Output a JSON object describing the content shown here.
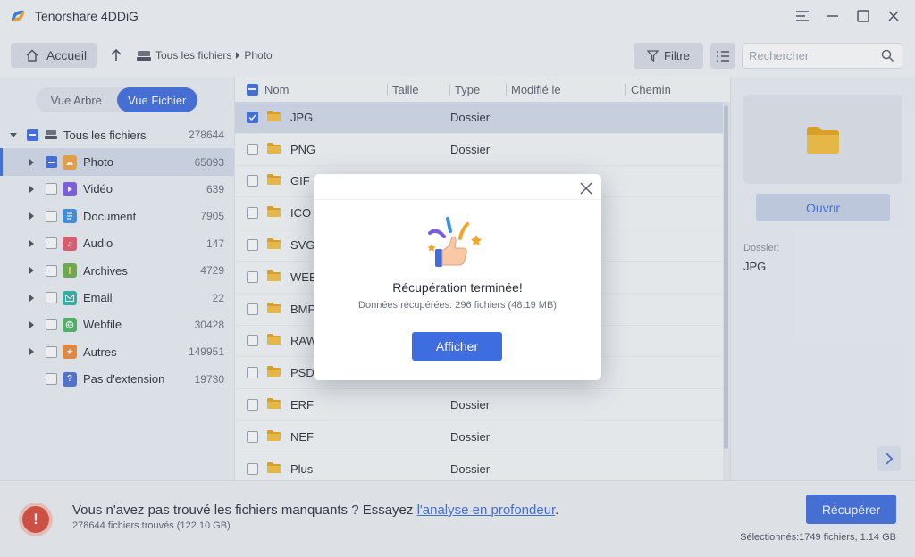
{
  "app": {
    "title": "Tenorshare 4DDiG",
    "brand_color": "#3d6de0"
  },
  "window_controls": [
    "menu-icon",
    "minimize-icon",
    "maximize-icon",
    "close-icon"
  ],
  "toolbar": {
    "home_label": "Accueil",
    "breadcrumb": [
      "Tous les fichiers",
      "Photo"
    ],
    "filter_label": "Filtre",
    "search_placeholder": "Rechercher"
  },
  "view_toggle": {
    "tree_label": "Vue Arbre",
    "file_label": "Vue Fichier",
    "active": "Vue Fichier"
  },
  "tree": {
    "root": {
      "label": "Tous les fichiers",
      "count": "278644"
    },
    "items": [
      {
        "label": "Photo",
        "count": "65093",
        "icon": "photo-icon",
        "color": "#f0a540"
      },
      {
        "label": "Vidéo",
        "count": "639",
        "icon": "video-icon",
        "color": "#7b5ce0"
      },
      {
        "label": "Document",
        "count": "7905",
        "icon": "document-icon",
        "color": "#3d8fe0"
      },
      {
        "label": "Audio",
        "count": "147",
        "icon": "audio-icon",
        "color": "#e55a6e"
      },
      {
        "label": "Archives",
        "count": "4729",
        "icon": "archive-icon",
        "color": "#6fae4e"
      },
      {
        "label": "Email",
        "count": "22",
        "icon": "email-icon",
        "color": "#2fb3a6"
      },
      {
        "label": "Webfile",
        "count": "30428",
        "icon": "webfile-icon",
        "color": "#4bb562"
      },
      {
        "label": "Autres",
        "count": "149951",
        "icon": "other-icon",
        "color": "#f08a3a"
      },
      {
        "label": "Pas d'extension",
        "count": "19730",
        "icon": "unknown-icon",
        "color": "#4d72d6"
      }
    ]
  },
  "file_list": {
    "columns": [
      "Nom",
      "Taille",
      "Type",
      "Modifié le",
      "Chemin"
    ],
    "rows": [
      {
        "name": "JPG",
        "type": "Dossier",
        "checked": true
      },
      {
        "name": "PNG",
        "type": "Dossier",
        "checked": false
      },
      {
        "name": "GIF",
        "type": "",
        "checked": false
      },
      {
        "name": "ICO",
        "type": "",
        "checked": false
      },
      {
        "name": "SVG",
        "type": "",
        "checked": false
      },
      {
        "name": "WEB",
        "type": "",
        "checked": false
      },
      {
        "name": "BMP",
        "type": "",
        "checked": false
      },
      {
        "name": "RAW",
        "type": "",
        "checked": false
      },
      {
        "name": "PSD",
        "type": "",
        "checked": false
      },
      {
        "name": "ERF",
        "type": "Dossier",
        "checked": false
      },
      {
        "name": "NEF",
        "type": "Dossier",
        "checked": false
      },
      {
        "name": "Plus",
        "type": "Dossier",
        "checked": false
      }
    ]
  },
  "preview": {
    "open_label": "Ouvrir",
    "meta_label": "Dossier:",
    "meta_value": "JPG"
  },
  "bottom": {
    "message_prefix": "Vous n'avez pas trouvé les fichiers manquants ? Essayez ",
    "message_link": "l'analyse en profondeur",
    "message_suffix": ".",
    "found_text": "278644 fichiers trouvés (122.10 GB)",
    "recover_label": "Récupérer",
    "selected_text": "Sélectionnés:1749 fichiers, 1.14 GB"
  },
  "modal": {
    "title": "Récupération terminée!",
    "subtitle": "Données récupérées: 296 fichiers (48.19 MB)",
    "button_label": "Afficher"
  }
}
